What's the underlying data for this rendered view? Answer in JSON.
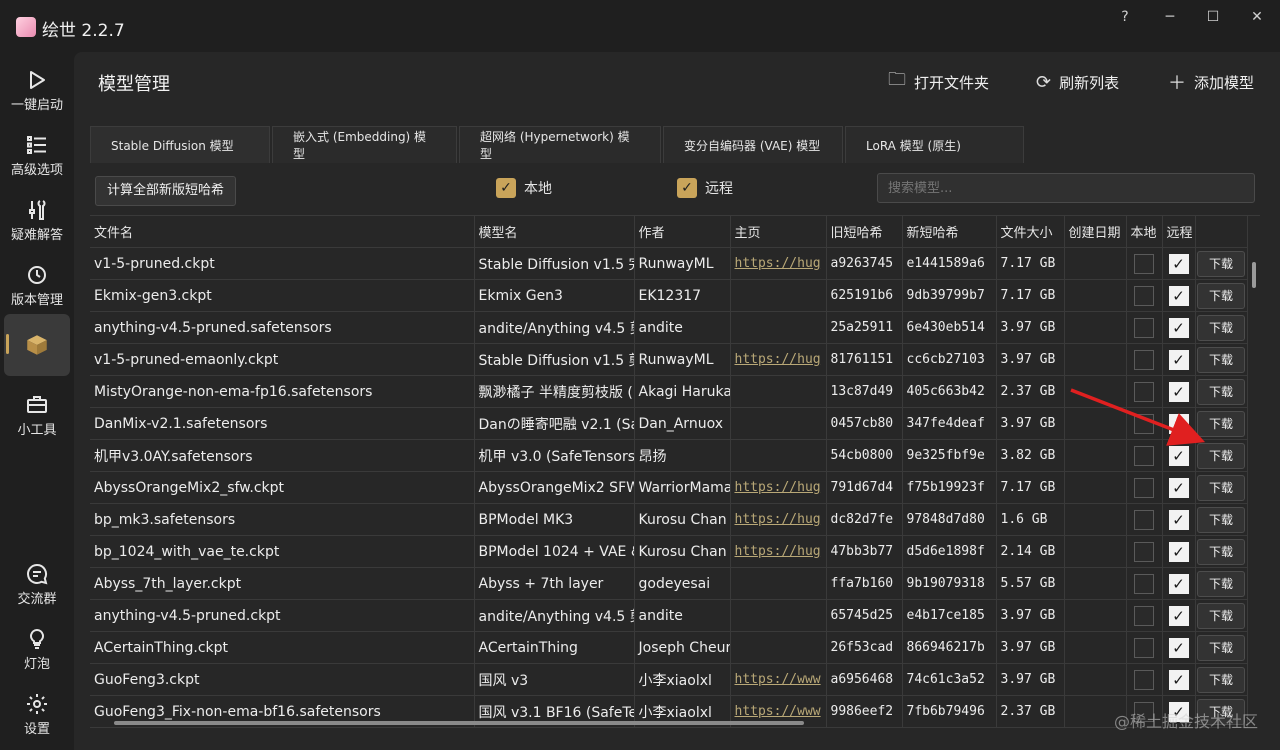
{
  "app": {
    "title": "绘世 2.2.7"
  },
  "window_controls": {
    "help": "?",
    "minimize": "─",
    "maximize": "☐",
    "close": "✕"
  },
  "sidebar": {
    "items": [
      {
        "label": "一键启动",
        "icon": "play-icon"
      },
      {
        "label": "高级选项",
        "icon": "list-icon"
      },
      {
        "label": "疑难解答",
        "icon": "wrench-icon"
      },
      {
        "label": "版本管理",
        "icon": "history-icon"
      },
      {
        "label": "",
        "icon": "box-icon",
        "active": true
      },
      {
        "label": "小工具",
        "icon": "toolbox-icon"
      }
    ],
    "bottom_items": [
      {
        "label": "交流群",
        "icon": "chat-icon"
      },
      {
        "label": "灯泡",
        "icon": "bulb-icon"
      },
      {
        "label": "设置",
        "icon": "gear-icon"
      }
    ]
  },
  "header": {
    "title": "模型管理",
    "actions": [
      {
        "label": "打开文件夹",
        "icon": "folder-icon"
      },
      {
        "label": "刷新列表",
        "icon": "refresh-icon"
      },
      {
        "label": "添加模型",
        "icon": "plus-icon"
      }
    ]
  },
  "tabs": [
    "Stable Diffusion 模型",
    "嵌入式 (Embedding) 模型",
    "超网络 (Hypernetwork) 模型",
    "变分自编码器 (VAE) 模型",
    "LoRA 模型 (原生)"
  ],
  "toolbar": {
    "hash_button": "计算全部新版短哈希",
    "filter_local": "本地",
    "filter_remote": "远程",
    "search_placeholder": "搜索模型..."
  },
  "table": {
    "columns": [
      "文件名",
      "模型名",
      "作者",
      "主页",
      "旧短哈希",
      "新短哈希",
      "文件大小",
      "创建日期",
      "本地",
      "远程",
      ""
    ],
    "download_label": "下载",
    "rows": [
      {
        "file": "v1-5-pruned.ckpt",
        "model": "Stable Diffusion v1.5 完",
        "author": "RunwayML",
        "home": "https://hug",
        "old": "a9263745",
        "new": "e1441589a6",
        "size": "7.17 GB",
        "local": false,
        "remote": true
      },
      {
        "file": "Ekmix-gen3.ckpt",
        "model": "Ekmix Gen3",
        "author": "EK12317",
        "home": "",
        "old": "625191b6",
        "new": "9db39799b7",
        "size": "7.17 GB",
        "local": false,
        "remote": true
      },
      {
        "file": "anything-v4.5-pruned.safetensors",
        "model": "andite/Anything v4.5 剪",
        "author": "andite",
        "home": "",
        "old": "25a25911",
        "new": "6e430eb514",
        "size": "3.97 GB",
        "local": false,
        "remote": true
      },
      {
        "file": "v1-5-pruned-emaonly.ckpt",
        "model": "Stable Diffusion v1.5 剪",
        "author": "RunwayML",
        "home": "https://hug",
        "old": "81761151",
        "new": "cc6cb27103",
        "size": "3.97 GB",
        "local": false,
        "remote": true
      },
      {
        "file": "MistyOrange-non-ema-fp16.safetensors",
        "model": "飘渺橘子 半精度剪枝版 (",
        "author": "Akagi Haruka",
        "home": "",
        "old": "13c87d49",
        "new": "405c663b42",
        "size": "2.37 GB",
        "local": false,
        "remote": true
      },
      {
        "file": "DanMix-v2.1.safetensors",
        "model": "Danの睡寄吧融 v2.1 (Sa",
        "author": "Dan_Arnuox",
        "home": "",
        "old": "0457cb80",
        "new": "347fe4deaf",
        "size": "3.97 GB",
        "local": false,
        "remote": true
      },
      {
        "file": "机甲v3.0AY.safetensors",
        "model": "机甲 v3.0 (SafeTensors)",
        "author": "昂扬",
        "home": "",
        "old": "54cb0800",
        "new": "9e325fbf9e",
        "size": "3.82 GB",
        "local": false,
        "remote": true
      },
      {
        "file": "AbyssOrangeMix2_sfw.ckpt",
        "model": "AbyssOrangeMix2 SFW",
        "author": "WarriorMama",
        "home": "https://hug",
        "old": "791d67d4",
        "new": "f75b19923f",
        "size": "7.17 GB",
        "local": false,
        "remote": true
      },
      {
        "file": "bp_mk3.safetensors",
        "model": "BPModel MK3",
        "author": "Kurosu Chan",
        "home": "https://hug",
        "old": "dc82d7fe",
        "new": "97848d7d80",
        "size": "1.6 GB",
        "local": false,
        "remote": true
      },
      {
        "file": "bp_1024_with_vae_te.ckpt",
        "model": "BPModel 1024 + VAE &",
        "author": "Kurosu Chan",
        "home": "https://hug",
        "old": "47bb3b77",
        "new": "d5d6e1898f",
        "size": "2.14 GB",
        "local": false,
        "remote": true
      },
      {
        "file": "Abyss_7th_layer.ckpt",
        "model": "Abyss + 7th layer",
        "author": "godeyesai",
        "home": "",
        "old": "ffa7b160",
        "new": "9b19079318",
        "size": "5.57 GB",
        "local": false,
        "remote": true
      },
      {
        "file": "anything-v4.5-pruned.ckpt",
        "model": "andite/Anything v4.5 剪",
        "author": "andite",
        "home": "",
        "old": "65745d25",
        "new": "e4b17ce185",
        "size": "3.97 GB",
        "local": false,
        "remote": true
      },
      {
        "file": "ACertainThing.ckpt",
        "model": "ACertainThing",
        "author": "Joseph Cheur",
        "home": "",
        "old": "26f53cad",
        "new": "866946217b",
        "size": "3.97 GB",
        "local": false,
        "remote": true
      },
      {
        "file": "GuoFeng3.ckpt",
        "model": "国风 v3",
        "author": "小李xiaolxl",
        "home": "https://www",
        "old": "a6956468",
        "new": "74c61c3a52",
        "size": "3.97 GB",
        "local": false,
        "remote": true
      },
      {
        "file": "GuoFeng3_Fix-non-ema-bf16.safetensors",
        "model": "国风 v3.1 BF16 (SafeTer",
        "author": "小李xiaolxl",
        "home": "https://www",
        "old": "9986eef2",
        "new": "7fb6b79496",
        "size": "2.37 GB",
        "local": false,
        "remote": true
      }
    ]
  },
  "watermark": "@稀土掘金技术社区",
  "colors": {
    "accent": "#c9a45a",
    "annotation_arrow": "#e02020"
  }
}
